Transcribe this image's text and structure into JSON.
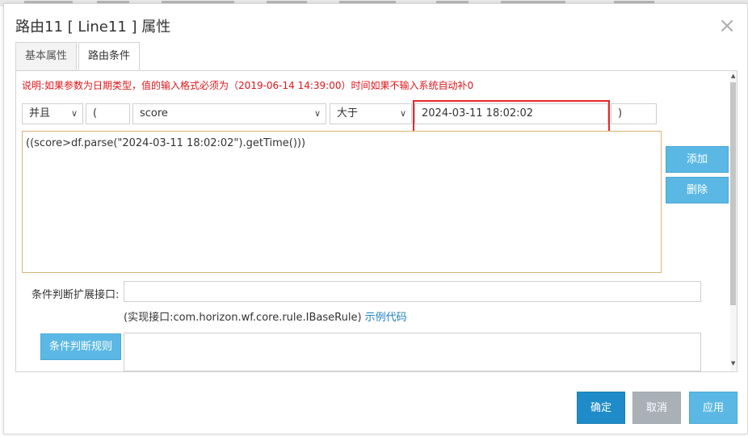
{
  "dialog": {
    "title": "路由11 [ Line11 ] 属性",
    "close_glyph": "×"
  },
  "tabs": [
    {
      "label": "基本属性",
      "active": false
    },
    {
      "label": "路由条件",
      "active": true
    }
  ],
  "note": "说明:如果参数为日期类型，值的输入格式必须为（2019-06-14 14:39:00）时间如果不输入系统自动补0",
  "condition_row": {
    "logic_select": "并且",
    "left_paren": "(",
    "field_select": "score",
    "operator_select": "大于",
    "value_input": "2024-03-11 18:02:02",
    "right_paren": ")"
  },
  "expression": "((score>df.parse(\"2024-03-11 18:02:02\").getTime()))",
  "side_buttons": {
    "add_label": "添加",
    "delete_label": "删除"
  },
  "extension": {
    "label": "条件判断扩展接口:",
    "value": "",
    "hint": "(实现接口:com.horizon.wf.core.rule.IBaseRule)",
    "example_link": "示例代码"
  },
  "rule_button": "条件判断规则",
  "footer": {
    "confirm_label": "确定",
    "cancel_label": "取消",
    "apply_label": "应用"
  },
  "colors": {
    "accent_blue": "#5bb8e4",
    "confirm_blue": "#1f8cc9",
    "disabled_gray": "#a9b1b7",
    "note_red": "#e0161b",
    "highlight_red": "#e8262b"
  }
}
